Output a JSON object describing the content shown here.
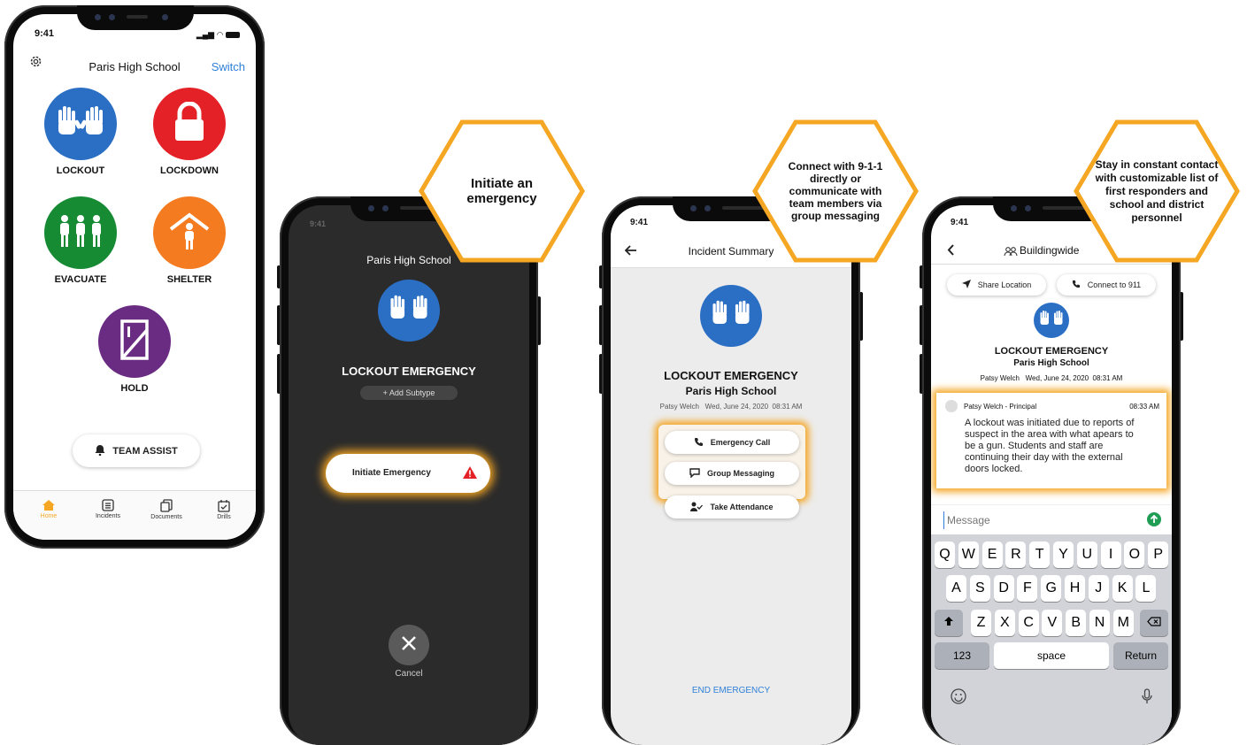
{
  "status_time": "9:41",
  "colors": {
    "accent": "#2f80d8",
    "lockout": "#2b6fc4",
    "lockdown": "#e32127",
    "evacuate": "#178a34",
    "shelter": "#f47b20",
    "hold": "#6a2c83",
    "hex_border": "#f5a623"
  },
  "phone1": {
    "header": {
      "school": "Paris High School",
      "switch_label": "Switch",
      "settings_icon": "gear-icon"
    },
    "actions": [
      {
        "label": "LOCKOUT",
        "icon": "raised-hands-icon"
      },
      {
        "label": "LOCKDOWN",
        "icon": "padlock-icon"
      },
      {
        "label": "EVACUATE",
        "icon": "people-walking-icon"
      },
      {
        "label": "SHELTER",
        "icon": "shelter-person-icon"
      },
      {
        "label": "HOLD",
        "icon": "door-icon"
      }
    ],
    "team_assist": "TEAM ASSIST",
    "tabs": [
      {
        "label": "Home",
        "icon": "home-icon"
      },
      {
        "label": "Incidents",
        "icon": "list-icon"
      },
      {
        "label": "Documents",
        "icon": "documents-icon"
      },
      {
        "label": "Drills",
        "icon": "calendar-check-icon"
      }
    ]
  },
  "phone2": {
    "school": "Paris High School",
    "title": "LOCKOUT EMERGENCY",
    "add_subtype": "+  Add Subtype",
    "initiate": "Initiate Emergency",
    "cancel": "Cancel"
  },
  "phone3": {
    "header": "Incident Summary",
    "title": "LOCKOUT EMERGENCY",
    "school": "Paris High School",
    "meta": "Patsy Welch   Wed, June 24, 2020  08:31 AM",
    "buttons": [
      "Emergency Call",
      "Group Messaging",
      "Take Attendance"
    ],
    "end": "END EMERGENCY"
  },
  "phone4": {
    "header": "Buildingwide",
    "share_location": "Share Location",
    "connect_911": "Connect to 911",
    "title": "LOCKOUT EMERGENCY",
    "school": "Paris High School",
    "meta": "Patsy Welch   Wed, June 24, 2020  08:31 AM",
    "message": {
      "author": "Patsy Welch - Principal",
      "time": "08:33 AM",
      "body": "A lockout was initiated due to reports of suspect in the area with what apears to be a gun. Students and staff are continuing their day with the external doors locked."
    },
    "input_placeholder": "Message",
    "keyboard": {
      "row1": [
        "Q",
        "W",
        "E",
        "R",
        "T",
        "Y",
        "U",
        "I",
        "O",
        "P"
      ],
      "row2": [
        "A",
        "S",
        "D",
        "F",
        "G",
        "H",
        "J",
        "K",
        "L"
      ],
      "row3": [
        "Z",
        "X",
        "C",
        "V",
        "B",
        "N",
        "M"
      ],
      "numbers": "123",
      "space": "space",
      "return": "Return"
    }
  },
  "callouts": [
    "Initiate an emergency",
    "Connect with 9-1-1 directly or communicate with team members via group messaging",
    "Stay in constant contact with customizable list of first responders and school and district personnel"
  ]
}
